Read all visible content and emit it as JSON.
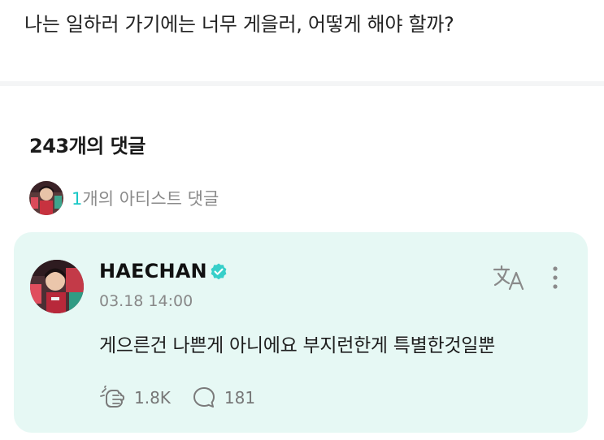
{
  "post": {
    "text": "나는 일하러 가기에는 너무 게을러, 어떻게 해야 할까?"
  },
  "comments": {
    "count_label": "243개의 댓글"
  },
  "artist_comments": {
    "count": "1",
    "label_rest": "개의 아티스트 댓글"
  },
  "comment": {
    "author": "HAECHAN",
    "timestamp": "03.18 14:00",
    "body": "게으른건 나쁜게 아니에요 부지런한게 특별한것일뿐",
    "likes": "1.8K",
    "replies": "181"
  },
  "colors": {
    "accent_teal": "#19c8c6",
    "card_background": "#e6f8f4",
    "verified_badge": "#36cfc9"
  },
  "icons": {
    "verified": "verified-badge-icon",
    "translate": "translate-icon",
    "more": "more-vertical-icon",
    "like": "cheer-hand-icon",
    "reply": "speech-bubble-icon"
  }
}
